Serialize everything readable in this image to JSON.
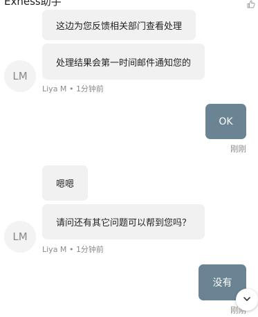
{
  "header": {
    "title": "Exness助手",
    "action_icon": "thumb-up-icon"
  },
  "messages": [
    {
      "sender": "agent",
      "text": "这边为您反馈相关部门查看处理"
    },
    {
      "sender": "agent",
      "text": "处理结果会第一时间邮件通知您的"
    },
    {
      "sender": "agent_meta",
      "avatar": "LM",
      "name": "Liya M",
      "separator": "•",
      "time": "1分钟前"
    },
    {
      "sender": "user",
      "text": "OK",
      "time": "刚刚"
    },
    {
      "sender": "agent",
      "text": "嗯嗯"
    },
    {
      "sender": "agent",
      "text": "请问还有其它问题可以帮到您吗？"
    },
    {
      "sender": "agent_meta",
      "avatar": "LM",
      "name": "Liya M",
      "separator": "•",
      "time": "1分钟前"
    },
    {
      "sender": "user",
      "text": "没有",
      "time": "刚刚"
    }
  ],
  "scroll_button": {
    "icon": "chevron-down-icon"
  },
  "colors": {
    "user_bubble": "#6a8494",
    "agent_bubble": "#f1f1f1",
    "meta_text": "#8a8a8a"
  }
}
